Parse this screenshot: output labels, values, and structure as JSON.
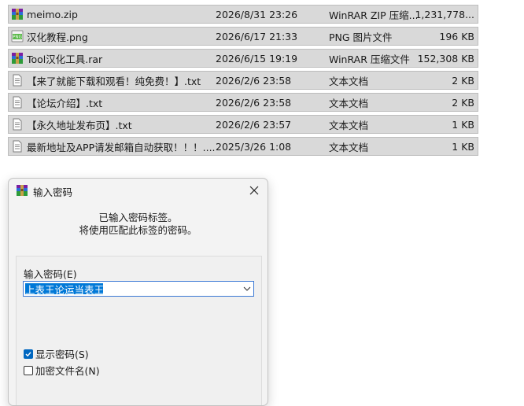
{
  "files": [
    {
      "name": "meimo.zip",
      "date": "2026/8/31 23:26",
      "type": "WinRAR ZIP 压缩...",
      "size": "1,231,778...",
      "icon": "winrar-archive-icon"
    },
    {
      "name": "汉化教程.png",
      "date": "2026/6/17 21:33",
      "type": "PNG 图片文件",
      "size": "196 KB",
      "icon": "png-image-icon"
    },
    {
      "name": "Tool汉化工具.rar",
      "date": "2026/6/15 19:19",
      "type": "WinRAR 压缩文件",
      "size": "152,308 KB",
      "icon": "winrar-archive-icon"
    },
    {
      "name": "【来了就能下载和观看！纯免费！】.txt",
      "date": "2026/2/6 23:58",
      "type": "文本文档",
      "size": "2 KB",
      "icon": "text-document-icon"
    },
    {
      "name": "【论坛介绍】.txt",
      "date": "2026/2/6 23:58",
      "type": "文本文档",
      "size": "2 KB",
      "icon": "text-document-icon"
    },
    {
      "name": "【永久地址发布页】.txt",
      "date": "2026/2/6 23:57",
      "type": "文本文档",
      "size": "1 KB",
      "icon": "text-document-icon"
    },
    {
      "name": "最新地址及APP请发邮箱自动获取！！！....",
      "date": "2025/3/26 1:08",
      "type": "文本文档",
      "size": "1 KB",
      "icon": "text-document-icon"
    }
  ],
  "dialog": {
    "title": "输入密码",
    "message_line1": "已输入密码标签。",
    "message_line2": "将使用匹配此标签的密码。",
    "password_label": "输入密码(E)",
    "password_value": "上表王论运当表王",
    "show_password_label": "显示密码(S)",
    "show_password_checked": true,
    "encrypt_filenames_label": "加密文件名(N)",
    "encrypt_filenames_checked": false
  },
  "colors": {
    "row_bg": "#d9d9d9",
    "accent": "#0078d7",
    "dialog_bg": "#f3f3f3"
  }
}
